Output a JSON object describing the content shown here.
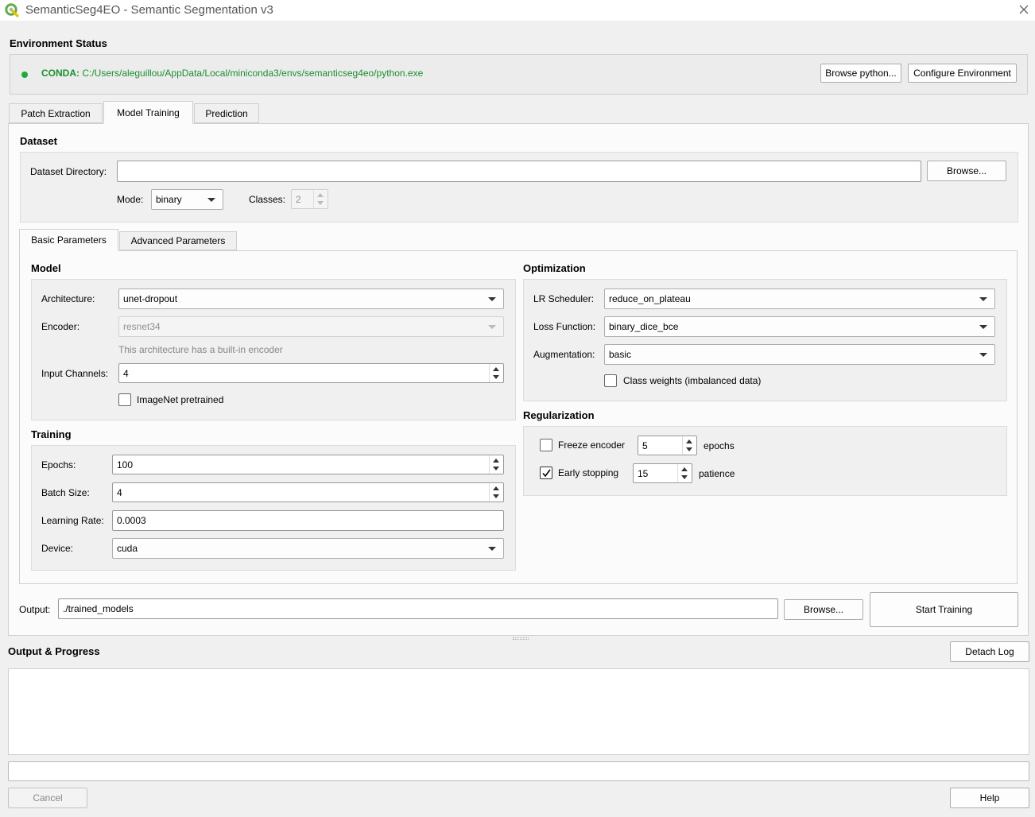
{
  "window": {
    "title": "SemanticSeg4EO - Semantic Segmentation v3",
    "close_icon": "close-icon"
  },
  "environment": {
    "heading": "Environment Status",
    "status_color": "#1faa3a",
    "label": "CONDA:",
    "path": "C:/Users/aleguillou/AppData/Local/miniconda3/envs/semanticseg4eo/python.exe",
    "browse_python": "Browse python...",
    "configure": "Configure Environment"
  },
  "tabs": [
    {
      "label": "Patch Extraction"
    },
    {
      "label": "Model Training",
      "active": true
    },
    {
      "label": "Prediction"
    }
  ],
  "dataset": {
    "heading": "Dataset",
    "dir_label": "Dataset Directory:",
    "dir_value": "",
    "browse": "Browse...",
    "mode_label": "Mode:",
    "mode_value": "binary",
    "classes_label": "Classes:",
    "classes_value": "2"
  },
  "param_tabs": [
    {
      "label": "Basic Parameters",
      "active": true
    },
    {
      "label": "Advanced Parameters"
    }
  ],
  "model": {
    "heading": "Model",
    "architecture_label": "Architecture:",
    "architecture_value": "unet-dropout",
    "encoder_label": "Encoder:",
    "encoder_value": "resnet34",
    "encoder_hint": "This architecture has a built-in encoder",
    "input_channels_label": "Input Channels:",
    "input_channels_value": "4",
    "imagenet_label": "ImageNet pretrained",
    "imagenet_checked": false
  },
  "training": {
    "heading": "Training",
    "epochs_label": "Epochs:",
    "epochs_value": "100",
    "batch_label": "Batch Size:",
    "batch_value": "4",
    "lr_label": "Learning Rate:",
    "lr_value": "0.0003",
    "device_label": "Device:",
    "device_value": "cuda"
  },
  "optimization": {
    "heading": "Optimization",
    "scheduler_label": "LR Scheduler:",
    "scheduler_value": "reduce_on_plateau",
    "loss_label": "Loss Function:",
    "loss_value": "binary_dice_bce",
    "augmentation_label": "Augmentation:",
    "augmentation_value": "basic",
    "class_weights_label": "Class weights (imbalanced data)",
    "class_weights_checked": false
  },
  "regularization": {
    "heading": "Regularization",
    "freeze_label": "Freeze encoder",
    "freeze_checked": false,
    "freeze_value": "5",
    "freeze_unit": "epochs",
    "early_label": "Early stopping",
    "early_checked": true,
    "early_value": "15",
    "early_unit": "patience"
  },
  "output": {
    "label": "Output:",
    "value": "./trained_models",
    "browse": "Browse...",
    "start": "Start Training"
  },
  "progress": {
    "heading": "Output & Progress",
    "detach": "Detach Log",
    "log_text": "",
    "progress_text": ""
  },
  "footer": {
    "cancel": "Cancel",
    "help": "Help"
  }
}
